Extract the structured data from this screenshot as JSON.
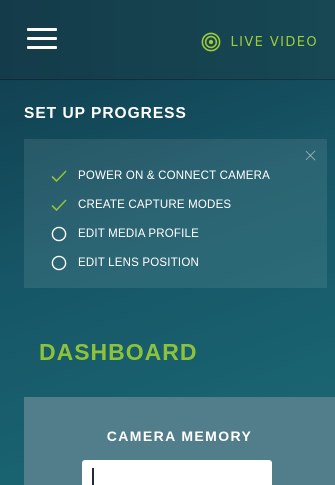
{
  "header": {
    "live_video_label": "LIVE VIDEO",
    "menu_icon": "hamburger-menu-icon",
    "live_icon": "live-broadcast-icon",
    "accent_color": "#9ccb3b"
  },
  "setup_progress": {
    "title": "SET UP PROGRESS",
    "steps": [
      {
        "label": "POWER ON & CONNECT CAMERA",
        "done": true
      },
      {
        "label": "CREATE CAPTURE MODES",
        "done": true
      },
      {
        "label": "EDIT MEDIA PROFILE",
        "done": false
      },
      {
        "label": "EDIT LENS POSITION",
        "done": false
      }
    ]
  },
  "dashboard": {
    "title": "DASHBOARD",
    "camera_memory": {
      "title": "CAMERA MEMORY"
    }
  }
}
